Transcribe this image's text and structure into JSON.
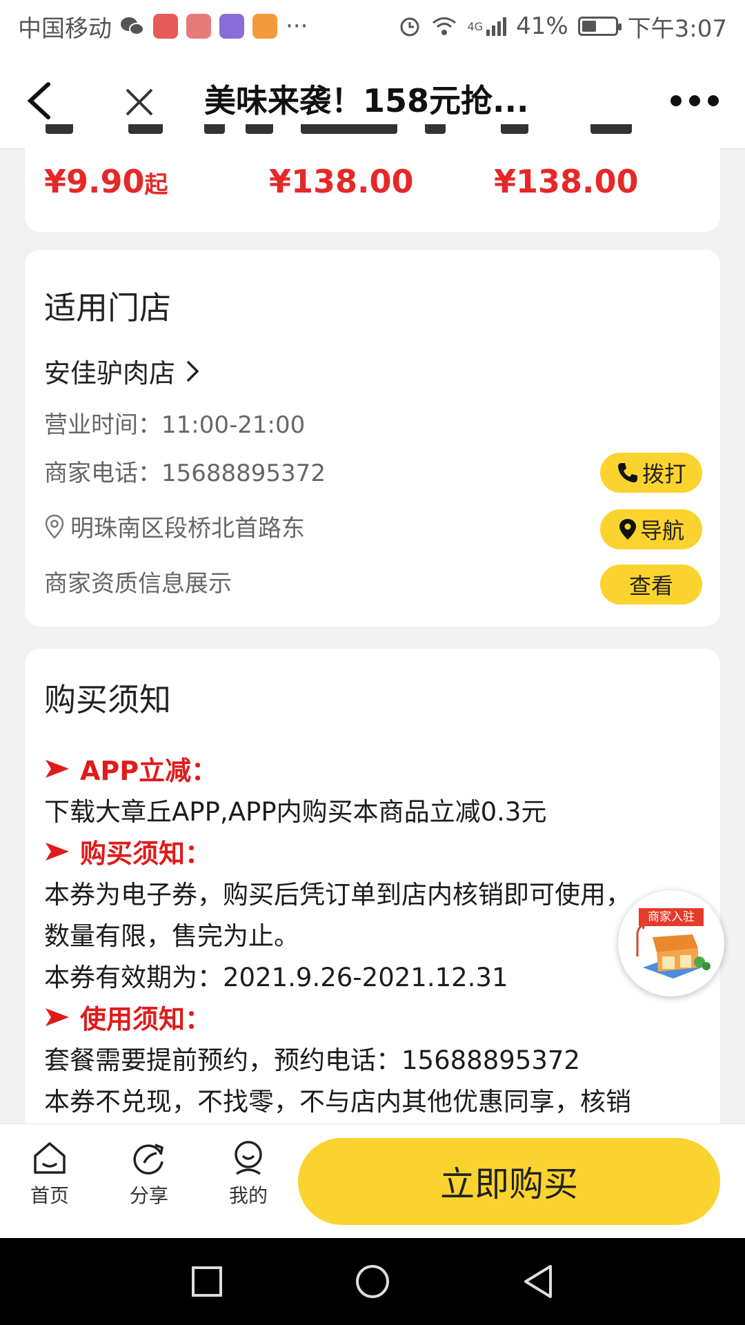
{
  "status_bar": {
    "carrier": "中国移动",
    "more": "···",
    "network": "4G",
    "battery": "41%",
    "time": "下午3:07"
  },
  "nav": {
    "title": "美味来袭！158元抢..."
  },
  "prices": {
    "p1": "¥9.90",
    "p1_suffix": "起",
    "p2": "¥138.00",
    "p3": "¥138.00"
  },
  "store": {
    "section_title": "适用门店",
    "name": "安佳驴肉店",
    "hours_label": "营业时间：",
    "hours": "11:00-21:00",
    "phone_label": "商家电话：",
    "phone": "15688895372",
    "address": "明珠南区段桥北首路东",
    "qualification": "商家资质信息展示",
    "call_label": "拨打",
    "nav_label": "导航",
    "view_label": "查看"
  },
  "notice": {
    "section_title": "购买须知",
    "head1": "APP立减：",
    "text1": "下载大章丘APP,APP内购买本商品立减0.3元",
    "head2": "购买须知：",
    "text2": "本券为电子券，购买后凭订单到店内核销即可使用，",
    "text3": "数量有限，售完为止。",
    "text4": "本券有效期为：2021.9.26-2021.12.31",
    "head3": "使用须知：",
    "text5": "套餐需要提前预约，预约电话：15688895372",
    "text6": "本券不兑现，不找零，不与店内其他优惠同享，核销"
  },
  "merchant_badge": {
    "label": "商家入驻"
  },
  "bottom": {
    "home": "首页",
    "share": "分享",
    "mine": "我的",
    "buy": "立即购买"
  },
  "colors": {
    "accent_yellow": "#fbd32e",
    "price_red": "#e62828",
    "notice_red": "#e01b1b"
  }
}
